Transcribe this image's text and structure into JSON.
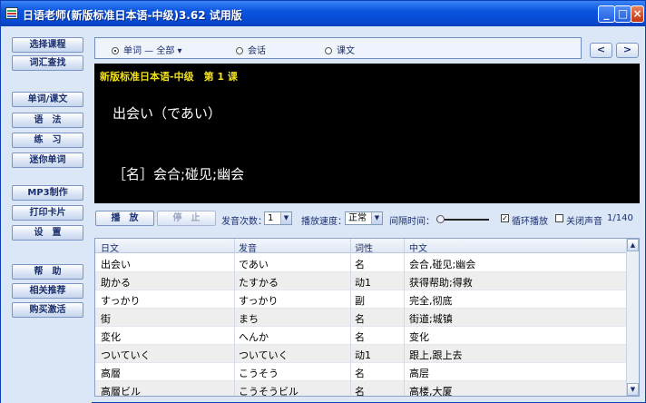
{
  "window": {
    "title": "日语老师(新版标准日本语-中级)3.62 试用版",
    "min": "_",
    "max": "□",
    "close": "×"
  },
  "sidebar": {
    "items": [
      {
        "label": "选择课程"
      },
      {
        "label": "词汇查找"
      },
      {
        "label": "单词/课文"
      },
      {
        "label": "语　法"
      },
      {
        "label": "练　习"
      },
      {
        "label": "迷你单词"
      },
      {
        "label": "MP3制作"
      },
      {
        "label": "打印卡片"
      },
      {
        "label": "设　置"
      },
      {
        "label": "帮　助"
      },
      {
        "label": "相关推荐"
      },
      {
        "label": "购买激活"
      }
    ]
  },
  "modes": {
    "words": "单词 — 全部 ▾",
    "dialogue": "会话",
    "text": "课文",
    "selected": "words"
  },
  "nav": {
    "prev": "<",
    "next": ">"
  },
  "display": {
    "lesson": "新版标准日本语-中级　第 1 课",
    "word": "出会い（であい）",
    "meaning": "［名］会合;碰见;幽会"
  },
  "controls": {
    "play": "播　放",
    "stop": "停　止",
    "repeat_label": "发音次数：",
    "repeat_value": "1",
    "speed_label": "播放速度：",
    "speed_value": "正常",
    "interval_label": "间隔时间：",
    "loop_label": "循环播放",
    "loop_checked": "✓",
    "mute_label": "关闭声音",
    "mute_checked": "",
    "counter": "1/140"
  },
  "table": {
    "headers": [
      "日文",
      "发音",
      "词性",
      "中文"
    ],
    "rows": [
      [
        "出会い",
        "であい",
        "名",
        "会合,碰见;幽会"
      ],
      [
        "助かる",
        "たすかる",
        "动1",
        "获得帮助;得救"
      ],
      [
        "すっかり",
        "すっかり",
        "副",
        "完全,彻底"
      ],
      [
        "街",
        "まち",
        "名",
        "街道;城镇"
      ],
      [
        "変化",
        "へんか",
        "名",
        "变化"
      ],
      [
        "ついていく",
        "ついていく",
        "动1",
        "跟上,跟上去"
      ],
      [
        "高層",
        "こうそう",
        "名",
        "高层"
      ],
      [
        "高層ビル",
        "こうそうビル",
        "名",
        "高楼,大厦"
      ]
    ],
    "scroll_up": "▲",
    "scroll_down": "▼"
  }
}
